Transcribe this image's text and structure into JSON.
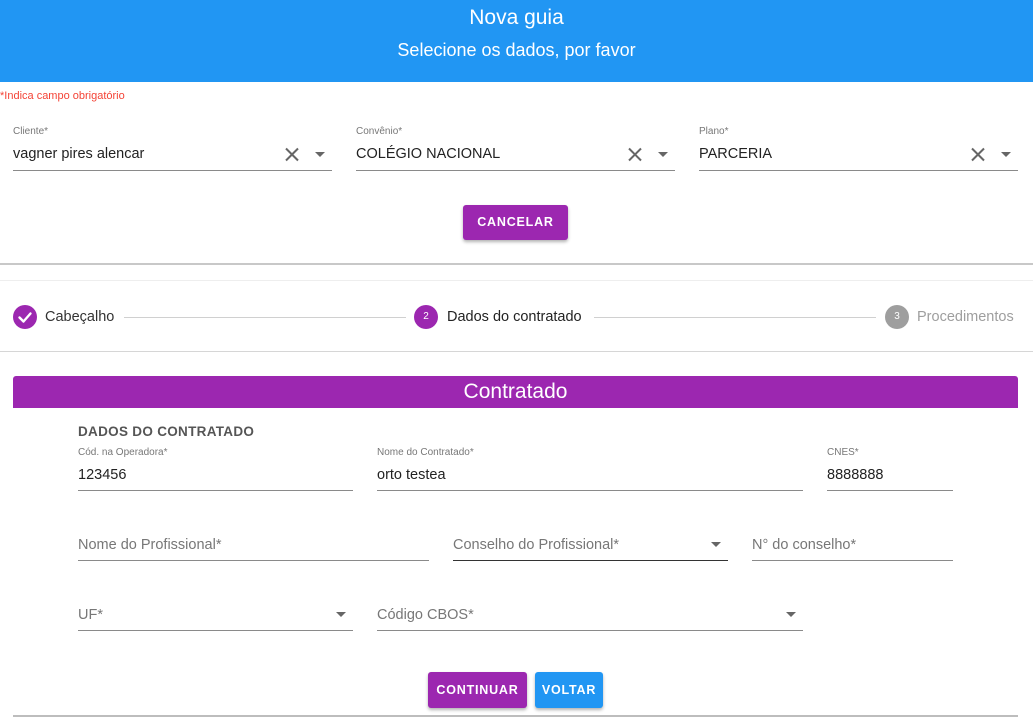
{
  "header": {
    "title": "Nova guia",
    "subtitle": "Selecione os dados, por favor"
  },
  "required_note": "*Indica campo obrigatório",
  "top_form": {
    "cliente": {
      "label": "Cliente*",
      "value": "vagner pires alencar"
    },
    "convenio": {
      "label": "Convênio*",
      "value": "COLÉGIO NACIONAL"
    },
    "plano": {
      "label": "Plano*",
      "value": "PARCERIA"
    },
    "cancel_label": "CANCELAR"
  },
  "stepper": {
    "steps": [
      {
        "number": "",
        "label": "Cabeçalho",
        "state": "done"
      },
      {
        "number": "2",
        "label": "Dados do contratado",
        "state": "active"
      },
      {
        "number": "3",
        "label": "Procedimentos",
        "state": "inactive"
      }
    ]
  },
  "contratado": {
    "bar_title": "Contratado",
    "section_title": "DADOS DO CONTRATADO",
    "cod_operadora": {
      "label": "Cód. na Operadora*",
      "value": "123456"
    },
    "nome_contratado": {
      "label": "Nome do Contratado*",
      "value": "orto testea"
    },
    "cnes": {
      "label": "CNES*",
      "value": "8888888"
    },
    "nome_profissional": {
      "placeholder": "Nome do Profissional*"
    },
    "conselho_profissional": {
      "placeholder": "Conselho do Profissional*"
    },
    "numero_conselho": {
      "placeholder": "N° do conselho*"
    },
    "uf": {
      "placeholder": "UF*"
    },
    "codigo_cbos": {
      "placeholder": "Código CBOS*"
    },
    "continue_label": "CONTINUAR",
    "back_label": "VOLTAR"
  },
  "colors": {
    "header_blue": "#2196f3",
    "accent_purple": "#9c27b0",
    "required_red": "#f44336",
    "inactive_gray": "#9e9e9e"
  }
}
